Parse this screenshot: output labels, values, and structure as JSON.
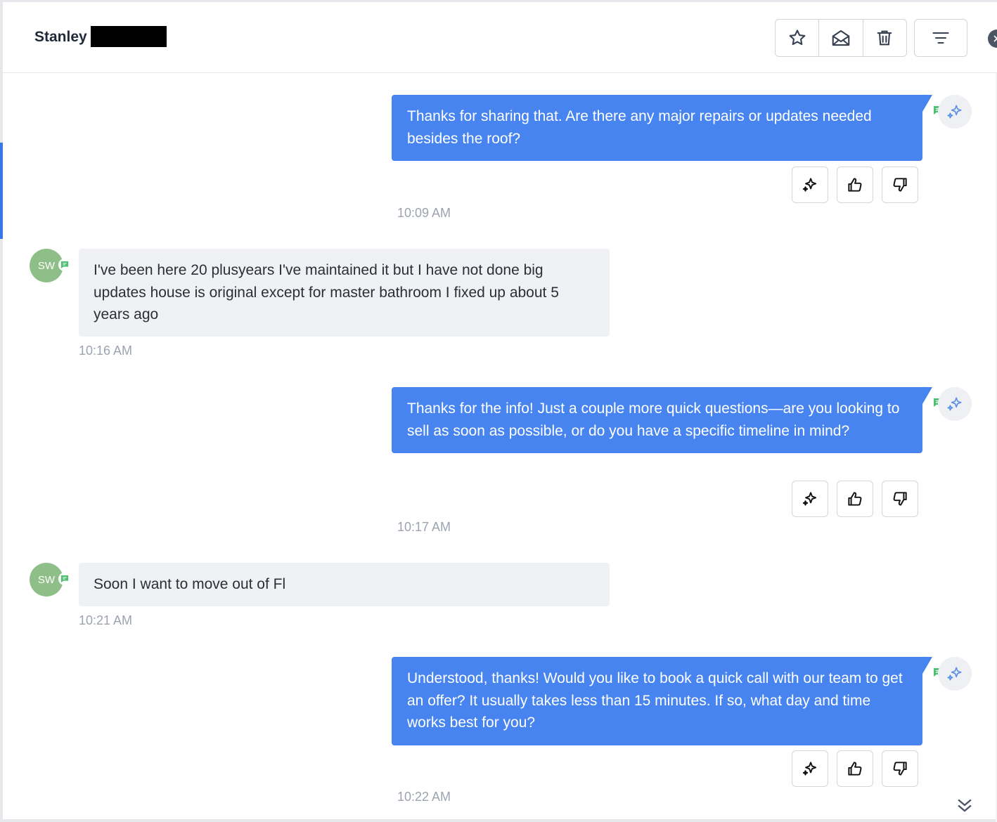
{
  "header": {
    "contact_name": "Stanley",
    "icons": [
      "star-icon",
      "mail-open-icon",
      "trash-icon",
      "filter-icon",
      "close-icon"
    ]
  },
  "colors": {
    "outgoing_bubble": "#4784f0",
    "incoming_bubble": "#f0f1f4",
    "avatar": "#8fbf88",
    "accent": "#3b76e8",
    "channel_green": "#4fbf73"
  },
  "messages": [
    {
      "direction": "outgoing",
      "text": "Thanks for sharing that. Are there any major repairs or updates needed besides the roof?",
      "time": "10:09 AM"
    },
    {
      "direction": "incoming",
      "avatar": "SW",
      "text": "I've been here 20 plusyears I've maintained it but I have not done big updates house is original except for master bathroom I fixed up about 5 years ago",
      "time": "10:16 AM"
    },
    {
      "direction": "outgoing",
      "text": "Thanks for the info! Just a couple more quick questions—are you looking to sell as soon as possible, or do you have a specific timeline in mind?",
      "time": "10:17 AM"
    },
    {
      "direction": "incoming",
      "avatar": "SW",
      "text": "Soon I want to move out of Fl",
      "time": "10:21 AM"
    },
    {
      "direction": "outgoing",
      "text": "Understood, thanks! Would you like to book a quick call with our team to get an offer? It usually takes less than 15 minutes. If so, what day and time works best for you?",
      "time": "10:22 AM"
    }
  ]
}
